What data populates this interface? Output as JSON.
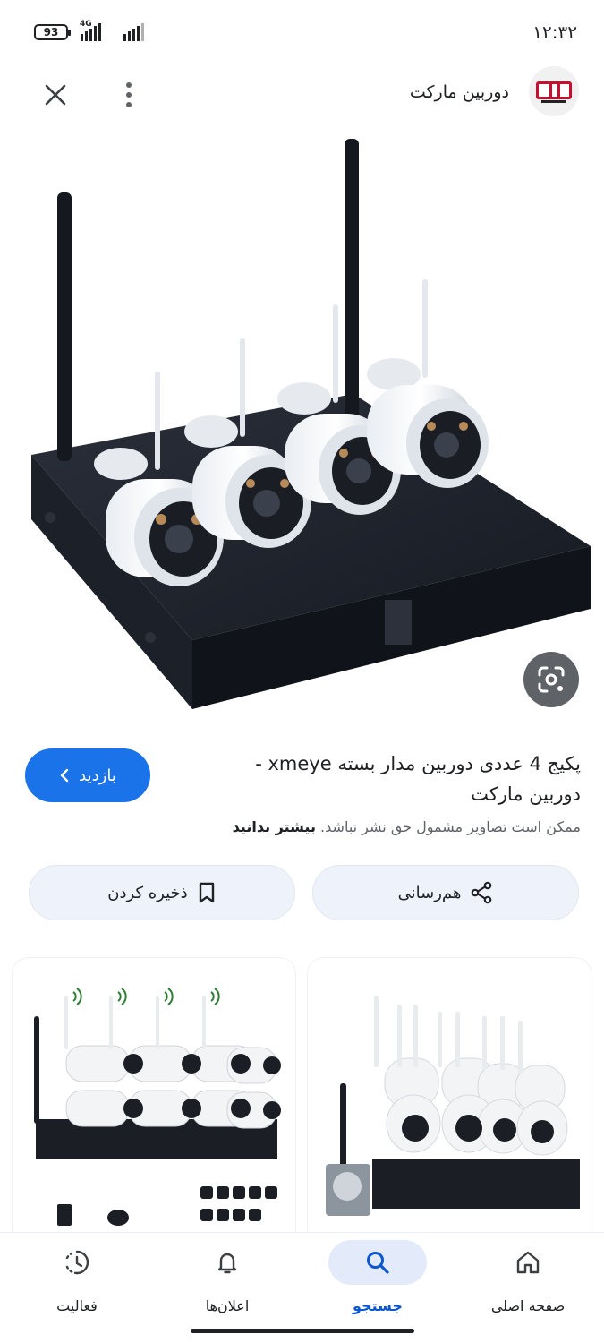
{
  "status_bar": {
    "time": "۱۲:۳۲",
    "battery": "93",
    "network": "4G"
  },
  "header": {
    "site_name": "دوربین مارکت",
    "logo_icon": "site-logo",
    "close_icon": "close-icon",
    "more_icon": "more-vert-icon"
  },
  "result": {
    "title": "پکیج 4 عددی دوربین مدار بسته xmeye - دوربین مارکت",
    "visit_label": "بازدید",
    "copyright_text": "ممکن است تصاویر مشمول حق نشر نباشد.",
    "learn_more": "بیشتر بدانید",
    "share_label": "هم‌رسانی",
    "save_label": "ذخیره کردن"
  },
  "nav": {
    "home": "صفحه اصلی",
    "search": "جستجو",
    "notifications": "اعلان‌ها",
    "activity": "فعالیت"
  },
  "colors": {
    "accent": "#1a73e8",
    "active_nav": "#0b57d0",
    "chip_bg": "#eef2fa"
  }
}
